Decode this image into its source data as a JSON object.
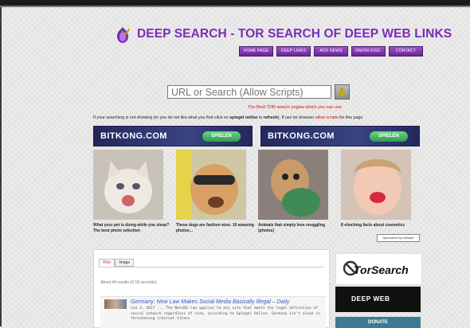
{
  "header": {
    "title": "DEEP SEARCH - TOR SEARCH OF DEEP WEB LINKS",
    "nav": [
      "HOME PAGE",
      "DEEP LINKS",
      "ADD NEWS",
      "ONION DISC.",
      "CONTACT"
    ]
  },
  "search": {
    "placeholder": "URL or Search (Allow Scripts)",
    "tagline": "The Best TOR search engine which you can use",
    "notice_pre": "If your searching is not showing (or you do not like what you find click on ",
    "notice_bold1": "spiegel online",
    "notice_mid": " to ",
    "notice_bold2": "refresh",
    "notice_mid2": "), If use tor browser ",
    "notice_red": "allow scripts",
    "notice_post": " for this page"
  },
  "ads": {
    "banners": [
      {
        "name": "BITKONG.COM",
        "button": "SPIELEN"
      },
      {
        "name": "BITKONG.COM",
        "button": "SPIELEN"
      }
    ],
    "items": [
      {
        "caption": "What your pet is doing while you sleep? The best photo selection"
      },
      {
        "caption": "These dogs are fashion wise. 10 amazing photos..."
      },
      {
        "caption": "Animals that simply love snuggling (photos)"
      },
      {
        "caption": "8 shocking facts about cosmetics"
      }
    ],
    "sponsored": "Sponsored by adhope"
  },
  "results": {
    "tabs": [
      "Web",
      "Image"
    ],
    "count": "About 44 results (0.18 seconds)",
    "items": [
      {
        "title": "Germany: New Law Makes Social Media Basically Illegal – Daily",
        "snippet": "Jun 3, 2017 ... The NetzDG law applies to any site that meets the legal definition of social network regardless of size, according to Spiegel Online. Germany isn't alone in threatening internet titans"
      }
    ]
  },
  "sidebar": {
    "logo": "TorSearch",
    "deep": "DEEP WEB",
    "donate": "DONATE"
  },
  "colors": {
    "accent": "#7a2cb8",
    "link": "#3b56c4",
    "alert": "#d01010"
  }
}
